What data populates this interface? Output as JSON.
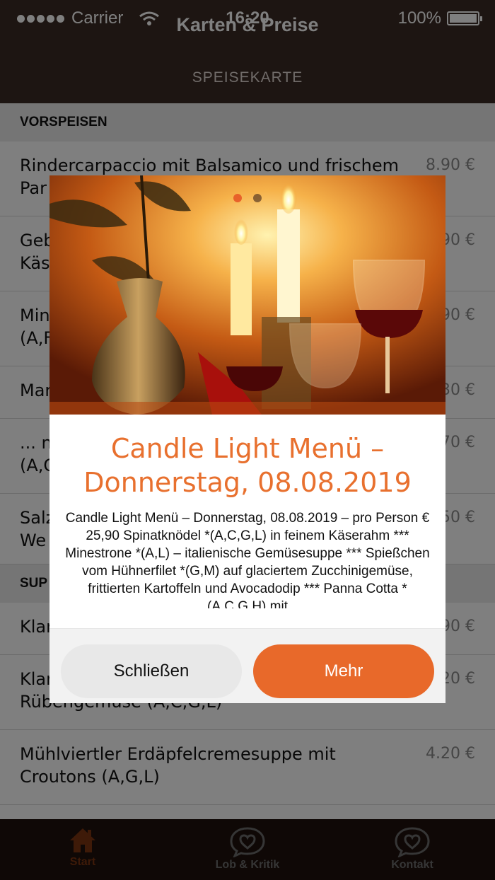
{
  "status_bar": {
    "carrier": "Carrier",
    "time": "16:20",
    "battery": "100%"
  },
  "header": {
    "title": "Karten & Preise",
    "subtitle": "SPEISEKARTE"
  },
  "menu": {
    "sections": [
      {
        "title": "VORSPEISEN",
        "items": [
          {
            "name": "Rindercarpaccio mit Balsamico und frischem Parmesan",
            "name_visible": "Rindercarpaccio mit Balsamico und frischem Par",
            "price": "8.90 €"
          },
          {
            "name": "Geb",
            "name_line2": "Käs",
            "price": "90 €"
          },
          {
            "name": "Min",
            "name_line2": "(A,F",
            "price": "90 €"
          },
          {
            "name": "Mar",
            "price": "30 €"
          },
          {
            "name": "... n",
            "name_line2": "(A,C",
            "price": "70 €"
          },
          {
            "name": "Salz",
            "name_line2": "We",
            "price": "50 €"
          }
        ]
      },
      {
        "title": "SUP",
        "items": [
          {
            "name": "Klar",
            "price": "90 €"
          },
          {
            "name": "Klar",
            "name_line2": "Rübengemüse (A,C,G,L)",
            "price": "20 €"
          },
          {
            "name": "Mühlviertler Erdäpfelcremesuppe mit",
            "name_line2": "Croutons (A,G,L)",
            "price": "4.20 €"
          }
        ]
      }
    ]
  },
  "modal": {
    "title": "Candle Light Menü – Donnerstag, 08.08.2019",
    "body": "Candle Light Menü – Donnerstag, 08.08.2019 – pro Person € 25,90 Spinatknödel *(A,C,G,L) in feinem Käserahm *** Minestrone *(A,L) – italienische Gemüsesuppe *** Spießchen vom Hühnerfilet *(G,M) auf glaciertem Zucchinigemüse, frittierten Kartoffeln und Avocadodip *** Panna Cotta *(A,C,G,H) mit",
    "close_label": "Schließen",
    "more_label": "Mehr",
    "pager": {
      "count": 2,
      "active": 0
    }
  },
  "tabs": [
    {
      "label": "Start",
      "icon": "home-icon",
      "active": true
    },
    {
      "label": "Lob & Kritik",
      "icon": "heart-bubble-icon",
      "active": false
    },
    {
      "label": "Kontakt",
      "icon": "heart-bubble-icon",
      "active": false
    }
  ],
  "colors": {
    "accent": "#e8692a",
    "header_bg": "#3a2a24",
    "tabbar_bg": "#1e100c",
    "active_tab": "#7d3410"
  }
}
